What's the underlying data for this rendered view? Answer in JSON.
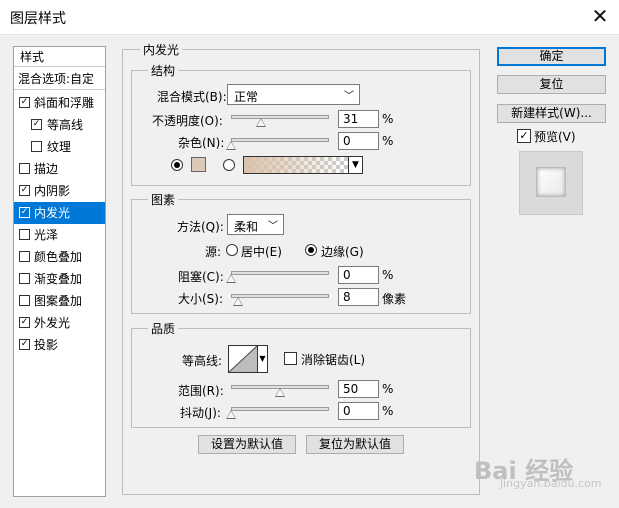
{
  "window": {
    "title": "图层样式"
  },
  "sidebar": {
    "header": "样式",
    "blend_options": "混合选项:自定",
    "items": [
      {
        "label": "斜面和浮雕",
        "checked": true,
        "selected": false,
        "sub": false
      },
      {
        "label": "等高线",
        "checked": true,
        "selected": false,
        "sub": true
      },
      {
        "label": "纹理",
        "checked": false,
        "selected": false,
        "sub": true
      },
      {
        "label": "描边",
        "checked": false,
        "selected": false,
        "sub": false
      },
      {
        "label": "内阴影",
        "checked": true,
        "selected": false,
        "sub": false
      },
      {
        "label": "内发光",
        "checked": true,
        "selected": true,
        "sub": false
      },
      {
        "label": "光泽",
        "checked": false,
        "selected": false,
        "sub": false
      },
      {
        "label": "颜色叠加",
        "checked": false,
        "selected": false,
        "sub": false
      },
      {
        "label": "渐变叠加",
        "checked": false,
        "selected": false,
        "sub": false
      },
      {
        "label": "图案叠加",
        "checked": false,
        "selected": false,
        "sub": false
      },
      {
        "label": "外发光",
        "checked": true,
        "selected": false,
        "sub": false
      },
      {
        "label": "投影",
        "checked": true,
        "selected": false,
        "sub": false
      }
    ]
  },
  "main": {
    "section_title": "内发光",
    "structure": {
      "title": "结构",
      "blend_mode_label": "混合模式(B):",
      "blend_mode_value": "正常",
      "opacity_label": "不透明度(O):",
      "opacity_value": "31",
      "opacity_unit": "%",
      "noise_label": "杂色(N):",
      "noise_value": "0",
      "noise_unit": "%",
      "color_swatch": "#dbc9b7",
      "mode": "color"
    },
    "elements": {
      "title": "图素",
      "method_label": "方法(Q):",
      "method_value": "柔和",
      "source_label": "源:",
      "source_center": "居中(E)",
      "source_edge": "边缘(G)",
      "source_selected": "edge",
      "choke_label": "阻塞(C):",
      "choke_value": "0",
      "choke_unit": "%",
      "size_label": "大小(S):",
      "size_value": "8",
      "size_unit": "像素"
    },
    "quality": {
      "title": "品质",
      "contour_label": "等高线:",
      "antialias_label": "消除锯齿(L)",
      "antialias_checked": false,
      "range_label": "范围(R):",
      "range_value": "50",
      "range_unit": "%",
      "jitter_label": "抖动(J):",
      "jitter_value": "0",
      "jitter_unit": "%"
    },
    "buttons": {
      "make_default": "设置为默认值",
      "reset_default": "复位为默认值"
    }
  },
  "right": {
    "ok": "确定",
    "reset": "复位",
    "new_style": "新建样式(W)...",
    "preview_label": "预览(V)",
    "preview_checked": true
  },
  "watermark": {
    "text": "Bai 经验",
    "sub": "jingyan.baidu.com"
  }
}
